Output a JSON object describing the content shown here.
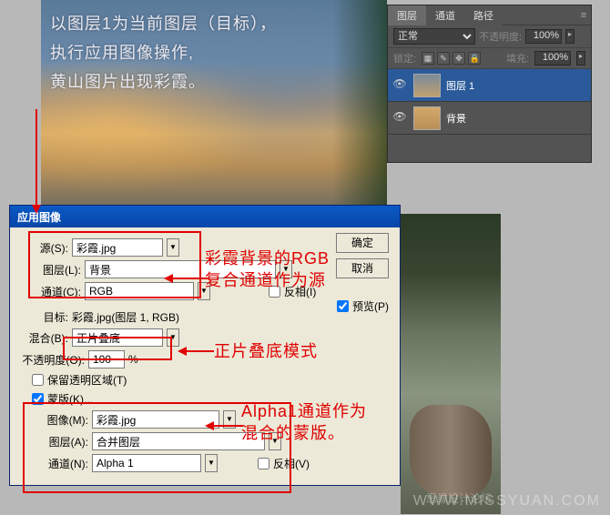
{
  "overlay": {
    "line1": "以图层1为当前图层（目标），",
    "line2": "执行应用图像操作,",
    "line3": "黄山图片出现彩霞。"
  },
  "layers_panel": {
    "tabs": [
      "图层",
      "通道",
      "路径"
    ],
    "blend_mode": "正常",
    "opacity_label": "不透明度:",
    "opacity_value": "100%",
    "lock_label": "锁定:",
    "fill_label": "填充:",
    "fill_value": "100%",
    "layers": [
      {
        "name": "图层 1",
        "selected": true
      },
      {
        "name": "背景",
        "selected": false
      }
    ]
  },
  "dialog": {
    "title": "应用图像",
    "source_label": "源(S):",
    "source_value": "彩霞.jpg",
    "layer_label": "图层(L):",
    "layer_value": "背景",
    "channel_label": "通道(C):",
    "channel_value": "RGB",
    "invert1_label": "反相(I)",
    "target_label": "目标:",
    "target_value": "彩霞.jpg(图层 1, RGB)",
    "blend_label": "混合(B):",
    "blend_value": "正片叠底",
    "opacity_label": "不透明度(O):",
    "opacity_value": "100",
    "opacity_unit": "%",
    "preserve_label": "保留透明区域(T)",
    "mask_label": "蒙版(K)...",
    "image_label": "图像(M):",
    "image_value": "彩霞.jpg",
    "mask_layer_label": "图层(A):",
    "mask_layer_value": "合并图层",
    "mask_channel_label": "通道(N):",
    "mask_channel_value": "Alpha 1",
    "invert2_label": "反相(V)",
    "ok_button": "确定",
    "cancel_button": "取消",
    "preview_label": "预览(P)"
  },
  "annotations": {
    "anno1_line1": "彩霞背景的RGB",
    "anno1_line2": "复合通道作为源",
    "anno2": "正片叠底模式",
    "anno3_line1": "Alpha1通道作为",
    "anno3_line2": "混合的蒙版。"
  },
  "watermark": "WWW.MISSYUAN.COM",
  "watermark_cn": "思缘设计论坛"
}
